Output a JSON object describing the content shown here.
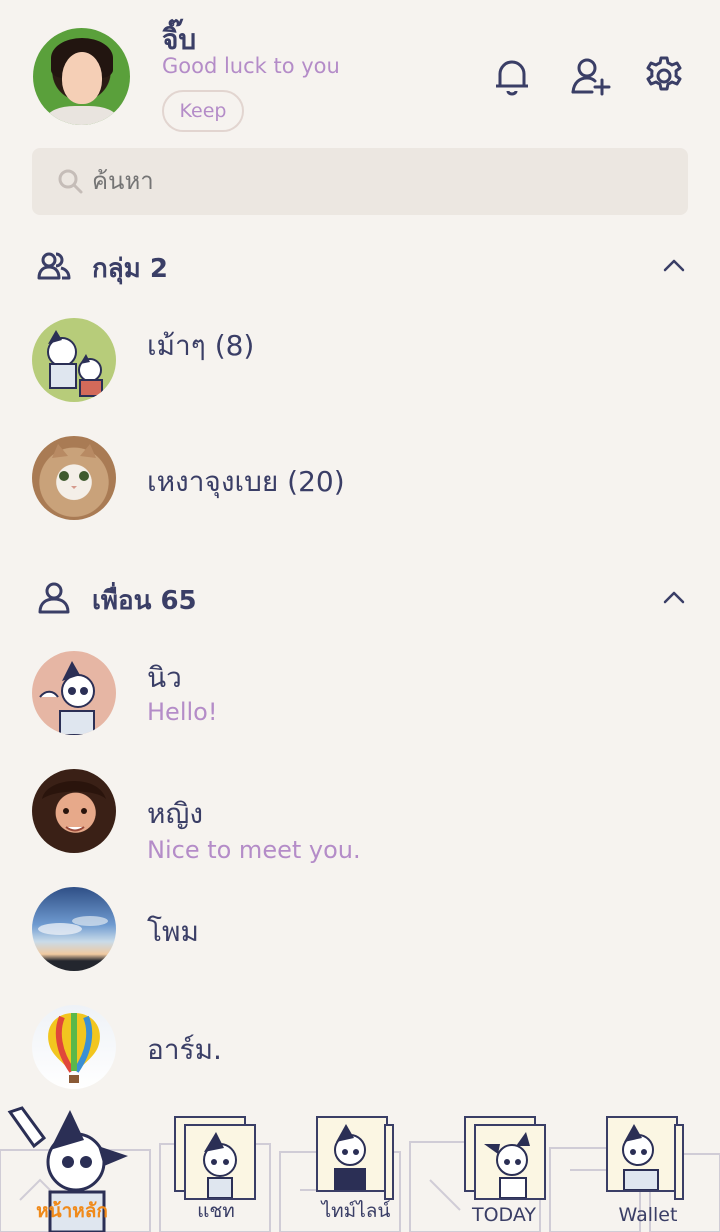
{
  "profile": {
    "name": "จิ๊บ",
    "status": "Good luck to you",
    "keep_label": "Keep"
  },
  "header_icons": [
    "bell-icon",
    "add-friend-icon",
    "gear-icon"
  ],
  "search": {
    "placeholder": "ค้นหา"
  },
  "groups": {
    "title": "กลุ่ม 2",
    "items": [
      {
        "name": "เม้าๆ (8)",
        "avatar": "cartoon-boys"
      },
      {
        "name": "เหงาจุงเบย (20)",
        "avatar": "cat-photo"
      }
    ]
  },
  "friends": {
    "title": "เพื่อน 65",
    "items": [
      {
        "name": "นิว",
        "message": "Hello!",
        "avatar": "cartoon-boy"
      },
      {
        "name": "หญิง",
        "message": "Nice to meet you.",
        "avatar": "woman-photo"
      },
      {
        "name": "โพม",
        "message": "",
        "avatar": "sky-photo"
      },
      {
        "name": "อาร์ม.",
        "message": "",
        "avatar": "balloon-photo"
      }
    ]
  },
  "nav": {
    "items": [
      {
        "label": "หน้าหลัก",
        "active": true
      },
      {
        "label": "แชท",
        "active": false
      },
      {
        "label": "ไทม์ไลน์",
        "active": false
      },
      {
        "label": "TODAY",
        "active": false
      },
      {
        "label": "Wallet",
        "active": false
      }
    ]
  },
  "colors": {
    "background": "#f6f3ef",
    "text": "#3a3e66",
    "accent_purple": "#b48cc8",
    "active_nav": "#f08a1a"
  }
}
